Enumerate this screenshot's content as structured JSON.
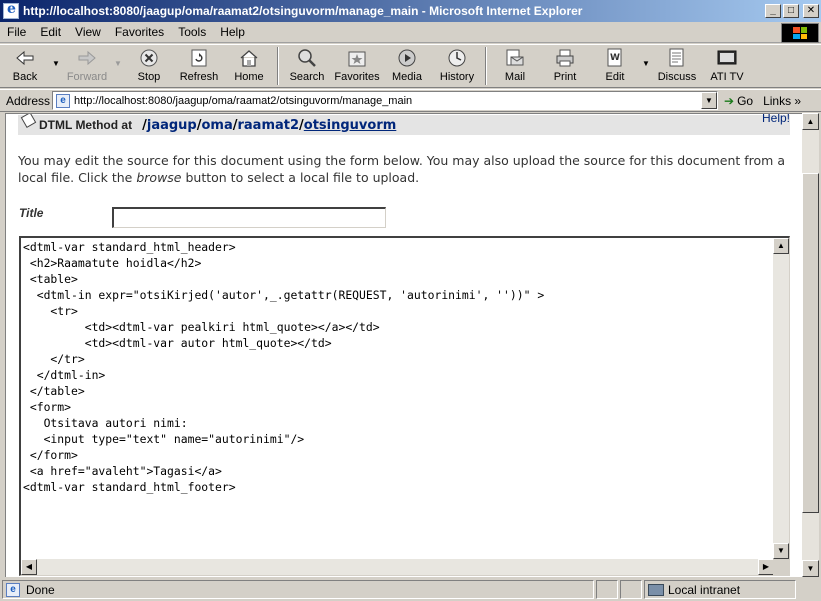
{
  "window": {
    "title": "http://localhost:8080/jaagup/oma/raamat2/otsinguvorm/manage_main - Microsoft Internet Explorer",
    "minimize": "_",
    "maximize": "□",
    "close": "✕"
  },
  "menu": {
    "items": [
      "File",
      "Edit",
      "View",
      "Favorites",
      "Tools",
      "Help"
    ]
  },
  "toolbar": {
    "back": "Back",
    "forward": "Forward",
    "stop": "Stop",
    "refresh": "Refresh",
    "home": "Home",
    "search": "Search",
    "favorites": "Favorites",
    "media": "Media",
    "history": "History",
    "mail": "Mail",
    "print": "Print",
    "edit": "Edit",
    "discuss": "Discuss",
    "ati_tv": "ATI TV"
  },
  "address": {
    "label": "Address",
    "url": "http://localhost:8080/jaagup/oma/raamat2/otsinguvorm/manage_main",
    "go": "Go",
    "links": "Links"
  },
  "page": {
    "meta_type": "DTML Method at",
    "breadcrumb": {
      "sep1": "/",
      "c1": "jaagup",
      "sep2": "/",
      "c2": "oma",
      "sep3": "/",
      "c3": "raamat2",
      "sep4": "/",
      "c4": "otsinguvorm"
    },
    "help": "Help!",
    "intro_1": "You may edit the source for this document using the form below. You may also upload the source for this document from a local file. Click the ",
    "intro_browse": "browse",
    "intro_2": " button to select a local file to upload.",
    "title_label": "Title",
    "title_value": "",
    "source": "<dtml-var standard_html_header>\n <h2>Raamatute hoidla</h2>\n <table>\n  <dtml-in expr=\"otsiKirjed('autor',_.getattr(REQUEST, 'autorinimi', ''))\" >\n    <tr>\n         <td><dtml-var pealkiri html_quote></a></td>\n         <td><dtml-var autor html_quote></td>\n    </tr>\n  </dtml-in>\n </table>\n <form>\n   Otsitava autori nimi:\n   <input type=\"text\" name=\"autorinimi\"/>\n </form>\n <a href=\"avaleht\">Tagasi</a>\n<dtml-var standard_html_footer>"
  },
  "status": {
    "text": "Done",
    "zone": "Local intranet"
  }
}
